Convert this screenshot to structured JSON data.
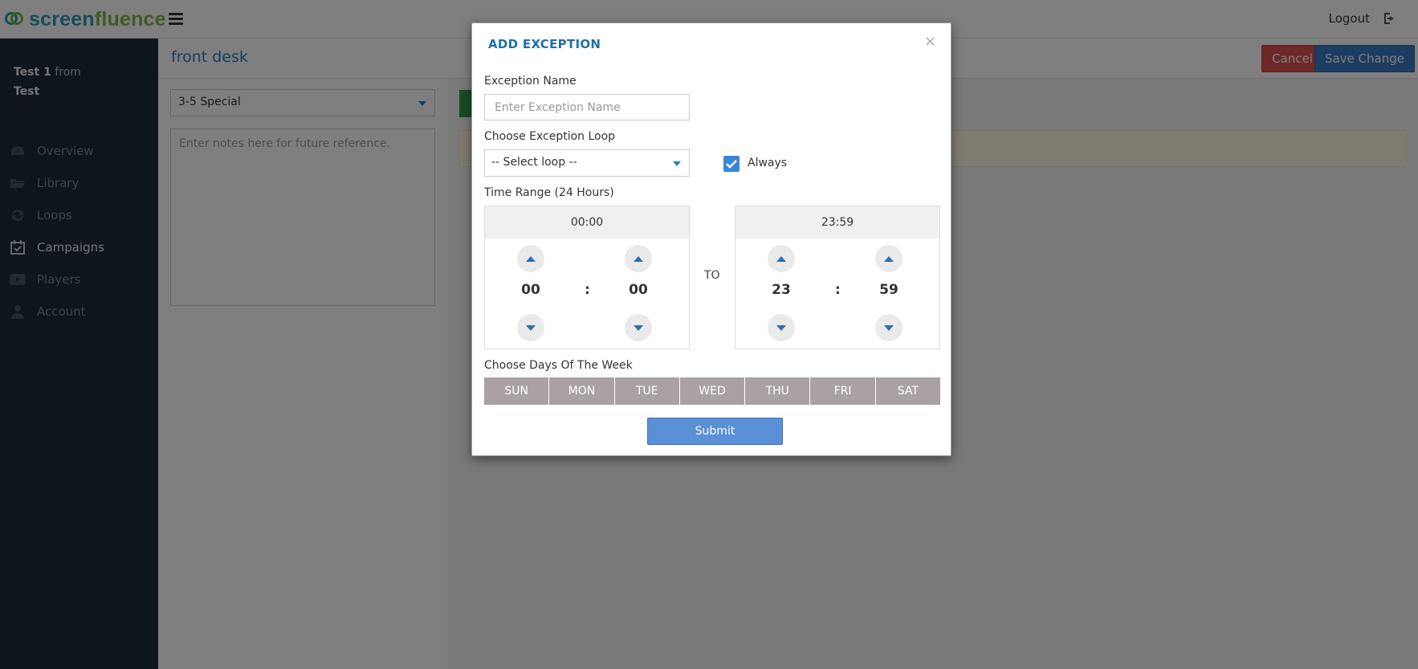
{
  "brand": {
    "part1": "screen",
    "part2": "fluence"
  },
  "topbar": {
    "logout_label": "Logout"
  },
  "user": {
    "name": "Test 1",
    "connector": "from",
    "org": "Test"
  },
  "sidebar": {
    "items": [
      {
        "label": "Overview",
        "icon": "dashboard-icon"
      },
      {
        "label": "Library",
        "icon": "folder-icon"
      },
      {
        "label": "Loops",
        "icon": "refresh-icon"
      },
      {
        "label": "Campaigns",
        "icon": "calendar-check-icon"
      },
      {
        "label": "Players",
        "icon": "youtube-play-icon"
      },
      {
        "label": "Account",
        "icon": "user-icon"
      }
    ],
    "active": "Campaigns"
  },
  "page": {
    "title": "front desk",
    "cancel_label": "Cancel",
    "save_label": "Save Change",
    "campaign_value": "3-5 Special",
    "notes_placeholder": "Enter notes here for future reference."
  },
  "modal": {
    "title": "ADD EXCEPTION",
    "close_symbol": "×",
    "name_label": "Exception Name",
    "name_placeholder": "Enter Exception Name",
    "loop_label": "Choose Exception Loop",
    "loop_value": "-- Select loop --",
    "always_label": "Always",
    "always_checked": true,
    "time_range_label": "Time Range (24 Hours)",
    "start": {
      "display": "00:00",
      "hours": "00",
      "minutes": "00"
    },
    "to_label": "TO",
    "end": {
      "display": "23:59",
      "hours": "23",
      "minutes": "59"
    },
    "colon": ":",
    "days_label": "Choose Days Of The Week",
    "days": [
      "SUN",
      "MON",
      "TUE",
      "WED",
      "THU",
      "FRI",
      "SAT"
    ],
    "submit_label": "Submit"
  },
  "colors": {
    "accent": "#2a7fb8",
    "sidebar_bg": "#1f2a3a",
    "danger": "#d9534f",
    "primary": "#3a78c2",
    "day_button": "#a9a1a6",
    "submit": "#5b8fd6"
  }
}
